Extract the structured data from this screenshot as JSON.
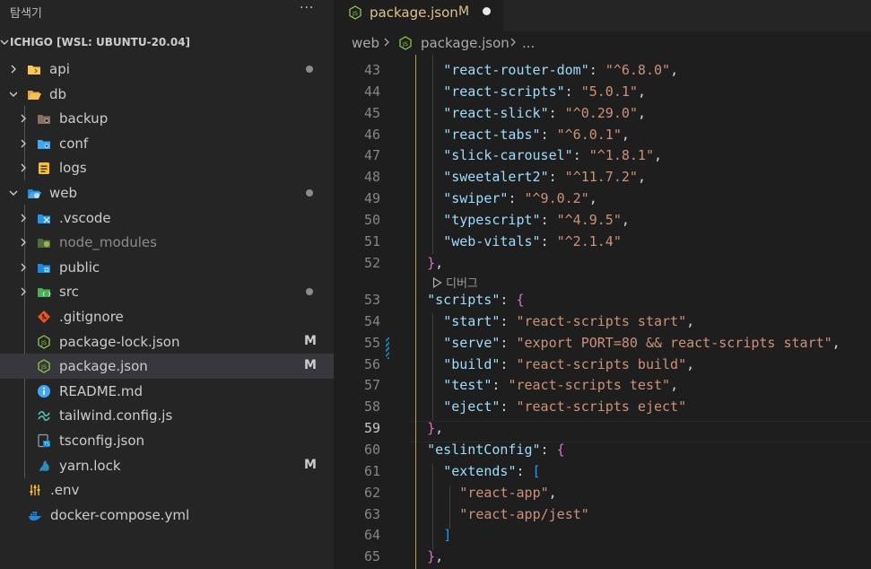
{
  "sidebar": {
    "title": "탐색기",
    "more_label": "···",
    "root_label": "ICHIGO [WSL: UBUNTU-20.04]",
    "items": [
      {
        "label": "api",
        "depth": 0,
        "twisty": "right",
        "icon": "folder-api-icon",
        "badge": "dot"
      },
      {
        "label": "db",
        "depth": 0,
        "twisty": "down",
        "icon": "folder-db-open-icon"
      },
      {
        "label": "backup",
        "depth": 1,
        "twisty": "right",
        "icon": "folder-backup-icon"
      },
      {
        "label": "conf",
        "depth": 1,
        "twisty": "right",
        "icon": "folder-config-icon"
      },
      {
        "label": "logs",
        "depth": 1,
        "twisty": "right",
        "icon": "folder-logs-icon"
      },
      {
        "label": "web",
        "depth": 0,
        "twisty": "down",
        "icon": "folder-web-open-icon",
        "badge": "dot"
      },
      {
        "label": ".vscode",
        "depth": 1,
        "twisty": "right",
        "icon": "folder-vscode-icon"
      },
      {
        "label": "node_modules",
        "depth": 1,
        "twisty": "right",
        "icon": "folder-node-icon",
        "dim": true
      },
      {
        "label": "public",
        "depth": 1,
        "twisty": "right",
        "icon": "folder-public-icon"
      },
      {
        "label": "src",
        "depth": 1,
        "twisty": "right",
        "icon": "folder-src-icon",
        "badge": "dot"
      },
      {
        "label": ".gitignore",
        "depth": 1,
        "twisty": "none",
        "icon": "git-icon"
      },
      {
        "label": "package-lock.json",
        "depth": 1,
        "twisty": "none",
        "icon": "nodejs-icon",
        "badge": "M"
      },
      {
        "label": "package.json",
        "depth": 1,
        "twisty": "none",
        "icon": "nodejs-icon",
        "badge": "M",
        "selected": true
      },
      {
        "label": "README.md",
        "depth": 1,
        "twisty": "none",
        "icon": "info-icon"
      },
      {
        "label": "tailwind.config.js",
        "depth": 1,
        "twisty": "none",
        "icon": "tailwind-icon"
      },
      {
        "label": "tsconfig.json",
        "depth": 1,
        "twisty": "none",
        "icon": "tsconfig-icon"
      },
      {
        "label": "yarn.lock",
        "depth": 1,
        "twisty": "none",
        "icon": "yarn-icon",
        "badge": "M"
      },
      {
        "label": ".env",
        "depth": 0,
        "twisty": "none",
        "icon": "env-tune-icon"
      },
      {
        "label": "docker-compose.yml",
        "depth": 0,
        "twisty": "none",
        "icon": "docker-icon"
      }
    ]
  },
  "tab": {
    "title": "package.json",
    "badge": "M"
  },
  "breadcrumb": {
    "items": [
      "web",
      "package.json",
      "..."
    ]
  },
  "codelens_label": "디버그",
  "editor": {
    "lines": [
      {
        "n": "43",
        "k": "react-router-dom",
        "v": "^6.8.0",
        "indent": 2,
        "comma": true
      },
      {
        "n": "44",
        "k": "react-scripts",
        "v": "5.0.1",
        "indent": 2,
        "comma": true
      },
      {
        "n": "45",
        "k": "react-slick",
        "v": "^0.29.0",
        "indent": 2,
        "comma": true
      },
      {
        "n": "46",
        "k": "react-tabs",
        "v": "^6.0.1",
        "indent": 2,
        "comma": true
      },
      {
        "n": "47",
        "k": "slick-carousel",
        "v": "^1.8.1",
        "indent": 2,
        "comma": true
      },
      {
        "n": "48",
        "k": "sweetalert2",
        "v": "^11.7.2",
        "indent": 2,
        "comma": true
      },
      {
        "n": "49",
        "k": "swiper",
        "v": "^9.0.2",
        "indent": 2,
        "comma": true
      },
      {
        "n": "50",
        "k": "typescript",
        "v": "^4.9.5",
        "indent": 2,
        "comma": true
      },
      {
        "n": "51",
        "k": "web-vitals",
        "v": "^2.1.4",
        "indent": 2,
        "comma": false
      },
      {
        "n": "52",
        "close": "}",
        "indent": 1,
        "comma": true,
        "bc": "b1"
      },
      {
        "n": "53",
        "k": "scripts",
        "open": "{",
        "indent": 1,
        "bc": "b1"
      },
      {
        "n": "54",
        "k": "start",
        "v": "react-scripts start",
        "indent": 2,
        "comma": true
      },
      {
        "n": "55",
        "k": "serve",
        "v": "export PORT=80 && react-scripts start",
        "indent": 2,
        "comma": true
      },
      {
        "n": "56",
        "k": "build",
        "v": "react-scripts build",
        "indent": 2,
        "comma": true
      },
      {
        "n": "57",
        "k": "test",
        "v": "react-scripts test",
        "indent": 2,
        "comma": true
      },
      {
        "n": "58",
        "k": "eject",
        "v": "react-scripts eject",
        "indent": 2,
        "comma": false
      },
      {
        "n": "59",
        "close": "}",
        "indent": 1,
        "comma": true,
        "bc": "b1",
        "active": true
      },
      {
        "n": "60",
        "k": "eslintConfig",
        "open": "{",
        "indent": 1,
        "bc": "b1"
      },
      {
        "n": "61",
        "k": "extends",
        "open": "[",
        "indent": 2,
        "bc": "b2"
      },
      {
        "n": "62",
        "s": "react-app",
        "indent": 3,
        "comma": true
      },
      {
        "n": "63",
        "s": "react-app/jest",
        "indent": 3,
        "comma": false
      },
      {
        "n": "64",
        "close": "]",
        "indent": 2,
        "comma": false,
        "bc": "b2"
      },
      {
        "n": "65",
        "close": "}",
        "indent": 1,
        "comma": true,
        "bc": "b1"
      }
    ]
  },
  "colors": {
    "modified": "#e2c08d",
    "sidebar_bg": "#252526",
    "editor_bg": "#1e1e1e",
    "selection": "#37373d",
    "json_key": "#9cdcfe",
    "json_string": "#ce9178",
    "bracket_1": "#da70d6",
    "bracket_2": "#179fff"
  }
}
